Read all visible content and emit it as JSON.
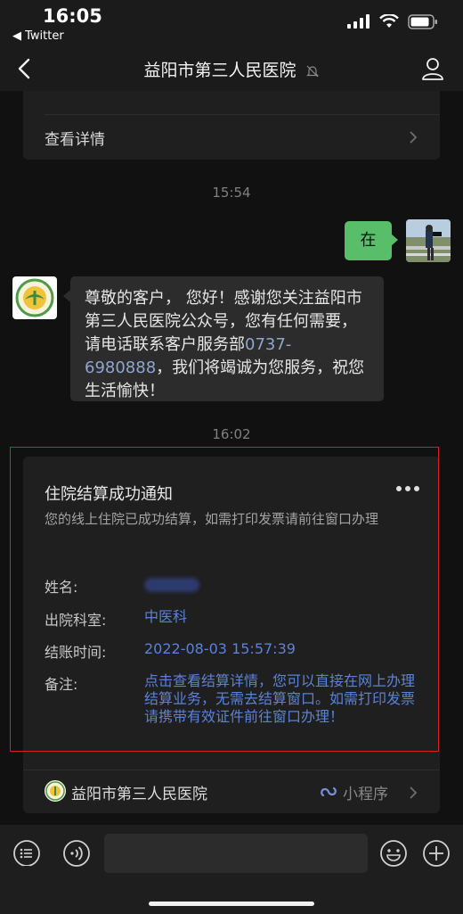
{
  "status_bar": {
    "time": "16:05",
    "back_app": "◀ Twitter",
    "icons": [
      "signal-icon",
      "wifi-icon",
      "battery-icon"
    ]
  },
  "nav": {
    "title": "益阳市第三人民医院",
    "icons": [
      "back-chevron-icon",
      "mute-bell-icon",
      "profile-icon"
    ]
  },
  "chat": {
    "prev_card": {
      "label": "查看详情"
    },
    "timestamps": [
      "15:54",
      "16:02"
    ],
    "my_message": {
      "text": "在"
    },
    "incoming": {
      "text_before": "尊敬的客户，  您好！感谢您关注益阳市第三人民医院公众号，您有任何需要，请电话联系客户服务部",
      "phone": "0737-6980888",
      "text_after": "，我们将竭诚为您服务，祝您生活愉快！"
    },
    "notice": {
      "title": "住院结算成功通知",
      "description": "您的线上住院已成功结算，如需打印发票请前往窗口办理",
      "fields": [
        {
          "label": "姓名:",
          "value": ""
        },
        {
          "label": "出院科室:",
          "value": "中医科"
        },
        {
          "label": "结账时间:",
          "value": "2022-08-03 15:57:39"
        },
        {
          "label": "备注:",
          "value": "点击查看结算详情，您可以直接在网上办理结算业务，无需去结算窗口。如需打印发票请携带有效证件前往窗口办理！"
        }
      ],
      "mini_program": {
        "name": "益阳市第三人民医院",
        "tag": "小程序"
      }
    }
  },
  "input_bar": {
    "icons": [
      "voice-icon",
      "audio-toggle-icon",
      "emoji-icon",
      "plus-icon"
    ]
  },
  "colors": {
    "background": "#111111",
    "bubble_sent": "#58be6a",
    "bubble_received": "#2c2c2c",
    "link_blue": "#5b82d6",
    "highlight_frame": "#d0241e"
  }
}
